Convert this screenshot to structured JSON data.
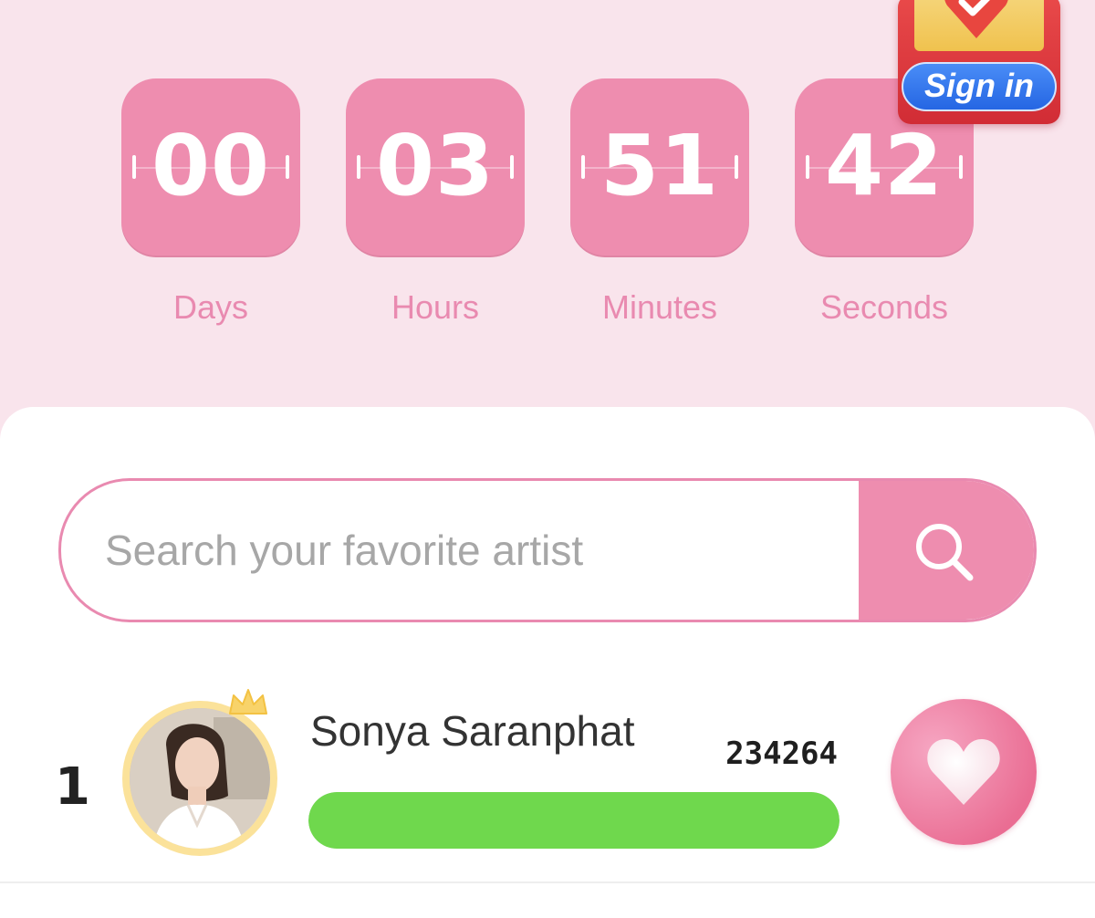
{
  "countdown": {
    "units": [
      {
        "value": "00",
        "label": "Days"
      },
      {
        "value": "03",
        "label": "Hours"
      },
      {
        "value": "51",
        "label": "Minutes"
      },
      {
        "value": "42",
        "label": "Seconds"
      }
    ]
  },
  "signin": {
    "label": "Sign in",
    "icon": "checkmark-heart-icon"
  },
  "search": {
    "placeholder": "Search your favorite artist",
    "value": "",
    "icon": "search-icon"
  },
  "ranking": [
    {
      "rank": "1",
      "name": "Sonya Saranphat",
      "votes": "234264",
      "progress": 1.0,
      "crown_icon": "crown-icon",
      "vote_icon": "heart-icon"
    }
  ],
  "colors": {
    "background": "#f9e4ec",
    "accent_pink": "#ee8daf",
    "label_pink": "#e98ab0",
    "progress_green": "#6fd84d",
    "signin_blue": "#2f73ea"
  }
}
